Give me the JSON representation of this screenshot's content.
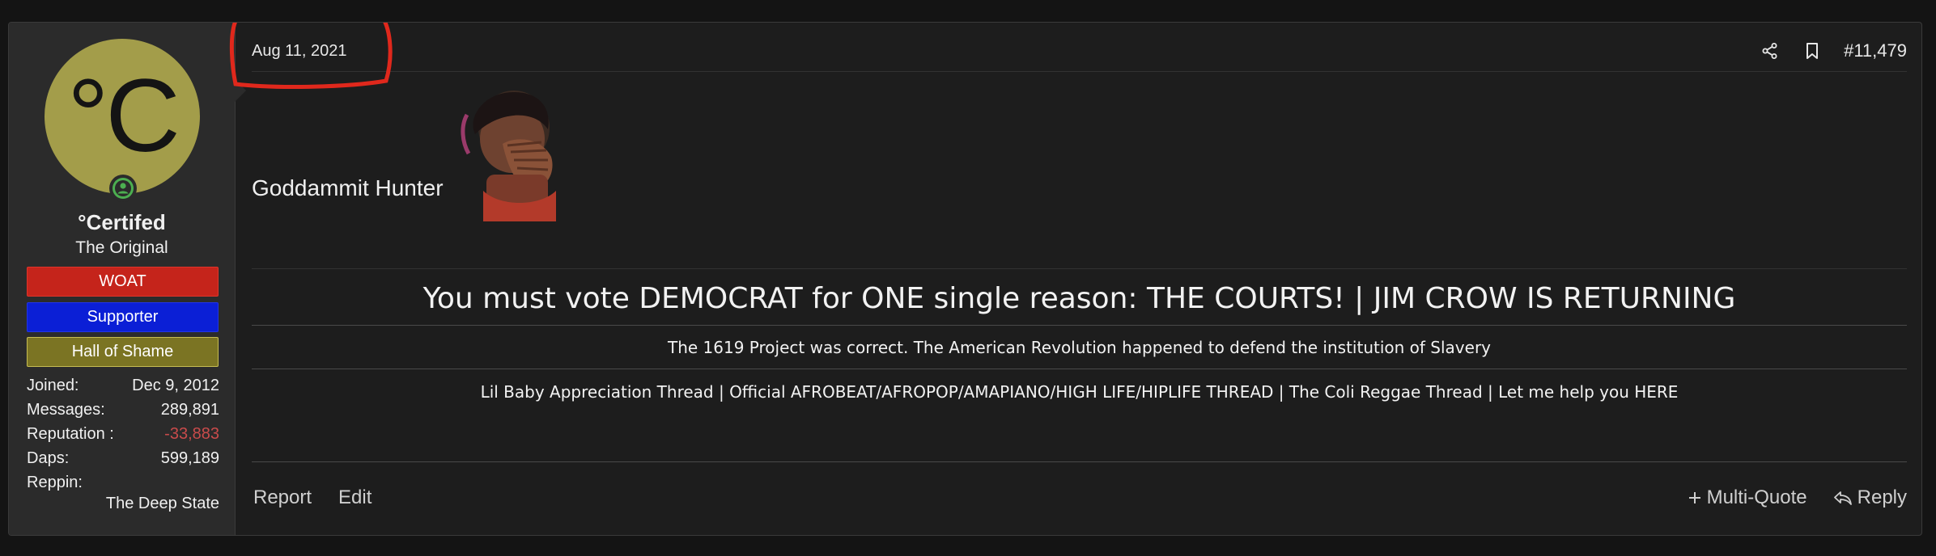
{
  "user": {
    "avatar_letter": "°C",
    "username": "°Certifed",
    "title": "The Original",
    "banners": [
      "WOAT",
      "Supporter",
      "Hall of Shame"
    ],
    "stats": [
      {
        "label": "Joined:",
        "value": "Dec 9, 2012"
      },
      {
        "label": "Messages:",
        "value": "289,891"
      },
      {
        "label": "Reputation :",
        "value": "-33,883"
      },
      {
        "label": "Daps:",
        "value": "599,189"
      },
      {
        "label": "Reppin:",
        "value": ""
      }
    ],
    "reppin_value": "The Deep State",
    "avatar_color": "#a39d4a",
    "online_color": "#4caf50"
  },
  "post": {
    "date": "Aug 11, 2021",
    "post_number": "#11,479",
    "body_text": "Goddammit Hunter",
    "annotation_color": "#e0281c"
  },
  "signature": {
    "headline": "You must vote DEMOCRAT for ONE single reason: THE COURTS! | JIM CROW IS RETURNING",
    "line2": "The 1619 Project was correct. The American Revolution happened to defend the institution of Slavery",
    "line3": "Lil Baby Appreciation Thread | Official AFROBEAT/AFROPOP/AMAPIANO/HIGH LIFE/HIPLIFE THREAD | The Coli Reggae Thread | Let me help you HERE"
  },
  "footer": {
    "report": "Report",
    "edit": "Edit",
    "multi_quote": "Multi-Quote",
    "reply": "Reply"
  }
}
